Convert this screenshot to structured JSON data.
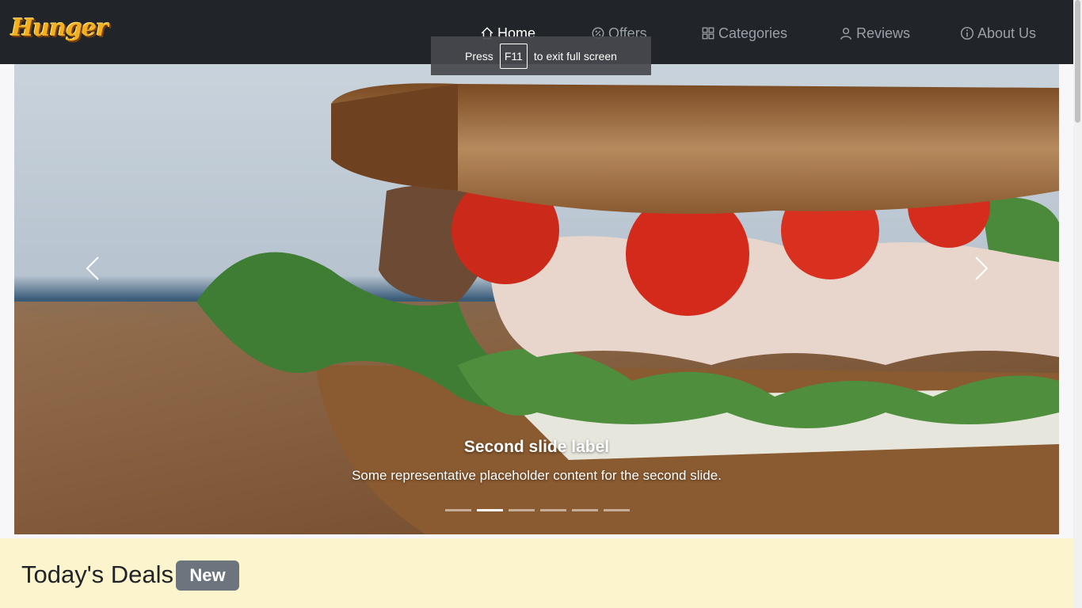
{
  "brand": {
    "logo_text": "Hunger"
  },
  "nav": {
    "home": "Home",
    "offers": "Offers",
    "categories": "Categories",
    "reviews": "Reviews",
    "about": "About Us"
  },
  "fullscreen_toast": {
    "before": "Press",
    "key": "F11",
    "after": "to exit full screen"
  },
  "carousel": {
    "caption_title": "Second slide label",
    "caption_text": "Some representative placeholder content for the second slide.",
    "slide_count": 6,
    "active_index": 1
  },
  "deals": {
    "title": "Today's Deals",
    "badge": "New"
  },
  "colors": {
    "navbar": "#212529",
    "deals_bg": "#fcf4cd",
    "badge": "#6c757d"
  }
}
